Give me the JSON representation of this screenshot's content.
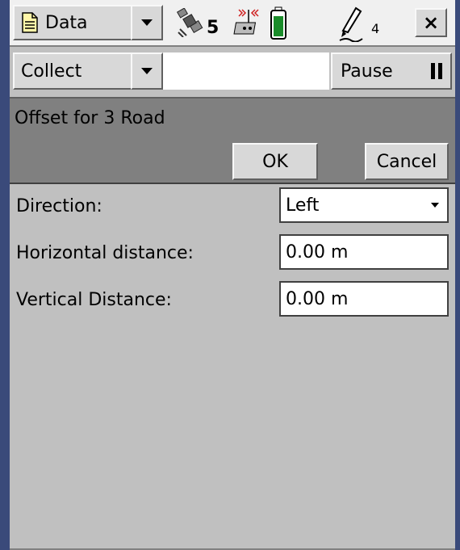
{
  "topbar": {
    "data_label": "Data",
    "satellite_count": "5",
    "pen_count": "4",
    "close_label": "×"
  },
  "toolbar": {
    "collect_label": "Collect",
    "pause_label": "Pause"
  },
  "dialog": {
    "title": "Offset for 3 Road",
    "ok_label": "OK",
    "cancel_label": "Cancel"
  },
  "form": {
    "direction_label": "Direction:",
    "direction_value": "Left",
    "horizontal_label": "Horizontal distance:",
    "horizontal_value": "0.00 m",
    "vertical_label": "Vertical Distance:",
    "vertical_value": "0.00 m"
  },
  "icons": {
    "data_menu": "document-icon",
    "satellite": "satellite-icon",
    "radio": "radio-icon",
    "battery": "battery-icon",
    "pen": "pen-icon",
    "pause": "pause-icon"
  },
  "colors": {
    "battery_fill": "#1a8c2a",
    "radio_signal": "#d02020"
  }
}
